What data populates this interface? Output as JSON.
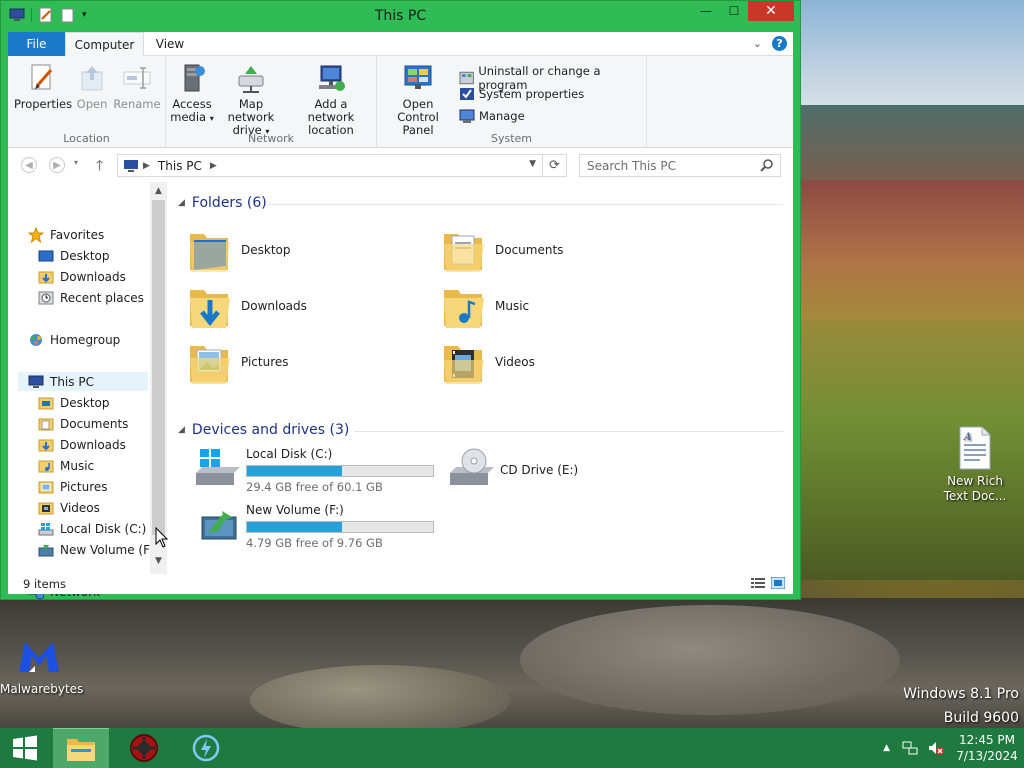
{
  "window": {
    "title": "This PC",
    "minimize_glyph": "—",
    "maximize_glyph": "☐",
    "close_glyph": "✕"
  },
  "ribbon": {
    "tabs": [
      {
        "label": "File"
      },
      {
        "label": "Computer"
      },
      {
        "label": "View"
      }
    ],
    "groups": [
      {
        "label": "Location",
        "buttons": [
          {
            "label": "Properties"
          },
          {
            "label": "Open"
          },
          {
            "label": "Rename"
          }
        ]
      },
      {
        "label": "Network",
        "buttons": [
          {
            "label": "Access media",
            "has_dropdown": true
          },
          {
            "label": "Map network drive",
            "has_dropdown": true
          },
          {
            "label": "Add a network location"
          }
        ]
      },
      {
        "label": "System",
        "buttons": [
          {
            "label": "Open Control Panel"
          }
        ],
        "small_buttons": [
          {
            "label": "Uninstall or change a program"
          },
          {
            "label": "System properties"
          },
          {
            "label": "Manage"
          }
        ]
      }
    ],
    "help_glyph": "?"
  },
  "address": {
    "crumb": "This PC",
    "search_placeholder": "Search This PC",
    "up_glyph": "🡑",
    "refresh_glyph": "⟳"
  },
  "navpane": {
    "favorites": {
      "label": "Favorites",
      "items": [
        {
          "label": "Desktop"
        },
        {
          "label": "Downloads"
        },
        {
          "label": "Recent places"
        }
      ]
    },
    "homegroup": {
      "label": "Homegroup"
    },
    "thispc": {
      "label": "This PC",
      "items": [
        {
          "label": "Desktop"
        },
        {
          "label": "Documents"
        },
        {
          "label": "Downloads"
        },
        {
          "label": "Music"
        },
        {
          "label": "Pictures"
        },
        {
          "label": "Videos"
        },
        {
          "label": "Local Disk (C:)"
        },
        {
          "label": "New Volume (F:)"
        }
      ]
    },
    "network": {
      "label": "Network"
    }
  },
  "content": {
    "folders_header": "Folders (6)",
    "folders": [
      {
        "label": "Desktop"
      },
      {
        "label": "Documents"
      },
      {
        "label": "Downloads"
      },
      {
        "label": "Music"
      },
      {
        "label": "Pictures"
      },
      {
        "label": "Videos"
      }
    ],
    "drives_header": "Devices and drives (3)",
    "drives": [
      {
        "label": "Local Disk (C:)",
        "free_text": "29.4 GB free of 60.1 GB",
        "used_fraction": 0.51
      },
      {
        "label": "CD Drive (E:)"
      },
      {
        "label": "New Volume (F:)",
        "free_text": "4.79 GB free of 9.76 GB",
        "used_fraction": 0.51
      }
    ]
  },
  "statusbar": {
    "items_text": "9 items"
  },
  "desktop": {
    "icons": [
      {
        "label": "New Rich Text Doc..."
      },
      {
        "label": "Malwarebytes"
      }
    ],
    "watermark": {
      "line1": "Windows 8.1 Pro",
      "line2": "Build 9600"
    }
  },
  "taskbar": {
    "clock_time": "12:45 PM",
    "clock_date": "7/13/2024"
  },
  "colors": {
    "window_frame": "#2fbc55",
    "file_tab": "#1979ca",
    "section_header": "#1e3287",
    "drive_bar": "#26a0da",
    "taskbar": "#1f7a3f"
  }
}
